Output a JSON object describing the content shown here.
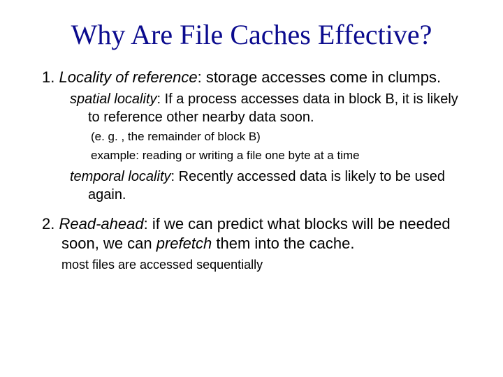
{
  "title": "Why Are File Caches Effective?",
  "item1": {
    "num": "1.",
    "lead": "Locality of reference",
    "rest": ": storage accesses come in clumps."
  },
  "spatial": {
    "lead": "spatial locality",
    "rest": ": If a process accesses data in block B, it is likely to reference other nearby data soon."
  },
  "spatial_sub1": "(e. g. , the remainder of block B)",
  "spatial_sub2": "example: reading or writing a file one byte at a time",
  "temporal": {
    "lead": "temporal locality",
    "rest": ": Recently accessed data is likely to be used again."
  },
  "item2": {
    "num": "2.",
    "lead": "Read-ahead",
    "mid": ": if we can predict what blocks will be needed soon, we can ",
    "em2": "prefetch",
    "rest": " them into the cache."
  },
  "tail": "most files are accessed sequentially"
}
